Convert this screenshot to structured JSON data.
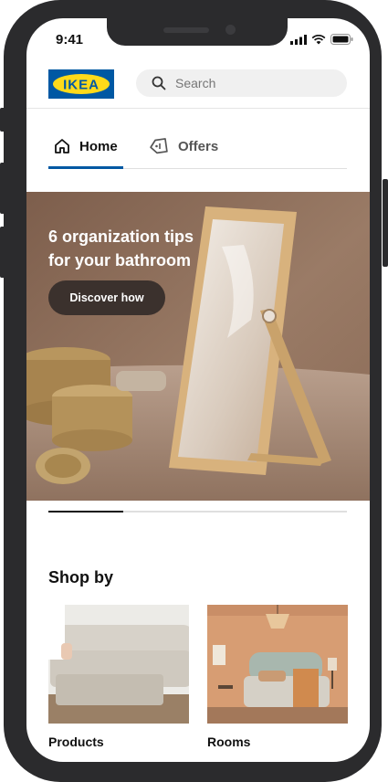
{
  "status": {
    "time": "9:41"
  },
  "header": {
    "logo_text": "IKEA",
    "search_placeholder": "Search"
  },
  "tabs": [
    {
      "label": "Home",
      "icon": "home-icon",
      "active": true
    },
    {
      "label": "Offers",
      "icon": "offer-tag-icon",
      "active": false
    }
  ],
  "hero": {
    "title_line1": "6 organization tips",
    "title_line2": "for your bathroom",
    "button_label": "Discover how"
  },
  "carousel": {
    "progress": 0.25
  },
  "shop_by": {
    "title": "Shop by",
    "items": [
      {
        "label": "Products"
      },
      {
        "label": "Rooms"
      }
    ]
  },
  "colors": {
    "brand_blue": "#0058a3",
    "brand_yellow": "#ffda1a",
    "button_dark": "#3b312d"
  }
}
